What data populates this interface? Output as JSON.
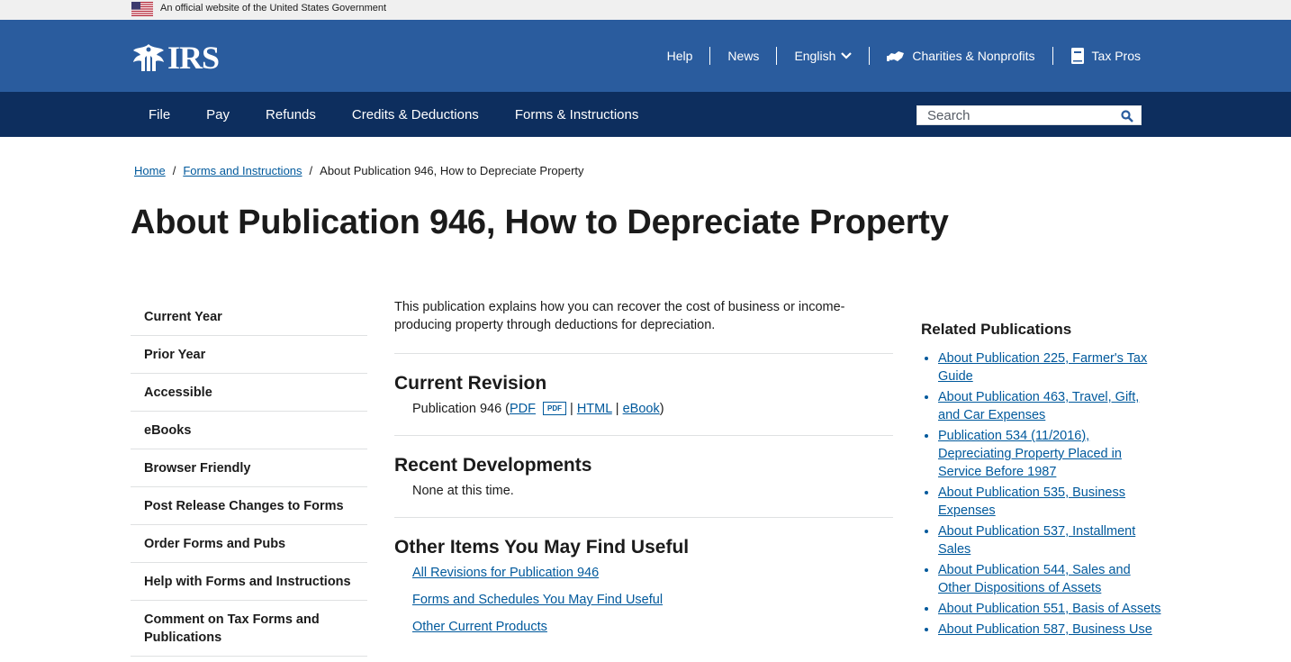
{
  "gov_banner": {
    "text": "An official website of the United States Government"
  },
  "header": {
    "logo_text": "IRS",
    "util_nav": {
      "help": "Help",
      "news": "News",
      "language": "English",
      "charities": "Charities & Nonprofits",
      "tax_pros": "Tax Pros"
    }
  },
  "main_nav": {
    "items": [
      "File",
      "Pay",
      "Refunds",
      "Credits & Deductions",
      "Forms & Instructions"
    ],
    "search_placeholder": "Search"
  },
  "breadcrumb": {
    "home": "Home",
    "forms": "Forms and Instructions",
    "current": "About Publication 946, How to Depreciate Property",
    "separator": "/"
  },
  "page_title": "About Publication 946, How to Depreciate Property",
  "sidebar": {
    "items": [
      "Current Year",
      "Prior Year",
      "Accessible",
      "eBooks",
      "Browser Friendly",
      "Post Release Changes to Forms",
      "Order Forms and Pubs",
      "Help with Forms and Instructions",
      "Comment on Tax Forms and Publications"
    ]
  },
  "content": {
    "intro": "This publication explains how you can recover the cost of business or income-producing property through deductions for depreciation.",
    "current_revision": {
      "heading": "Current Revision",
      "pub_name": "Publication 946 (",
      "pdf": "PDF",
      "pdf_badge": "PDF",
      "html": "HTML",
      "ebook": "eBook",
      "pipe": "|",
      "close": ")"
    },
    "recent_developments": {
      "heading": "Recent Developments",
      "text": "None at this time."
    },
    "other_items": {
      "heading": "Other Items You May Find Useful",
      "links": [
        "All Revisions for Publication 946",
        "Forms and Schedules You May Find Useful",
        "Other Current Products"
      ]
    }
  },
  "related": {
    "heading": "Related Publications",
    "links": [
      "About Publication 225, Farmer's Tax Guide",
      "About Publication 463, Travel, Gift, and Car Expenses",
      "Publication 534 (11/2016), Depreciating Property Placed in Service Before 1987",
      "About Publication 535, Business Expenses",
      "About Publication 537, Installment Sales",
      "About Publication 544, Sales and Other Dispositions of Assets",
      "About Publication 551, Basis of Assets",
      "About Publication 587, Business Use"
    ]
  },
  "colors": {
    "header_blue": "#2a5c9e",
    "nav_navy": "#0d2e5e",
    "link_blue": "#00599c"
  }
}
